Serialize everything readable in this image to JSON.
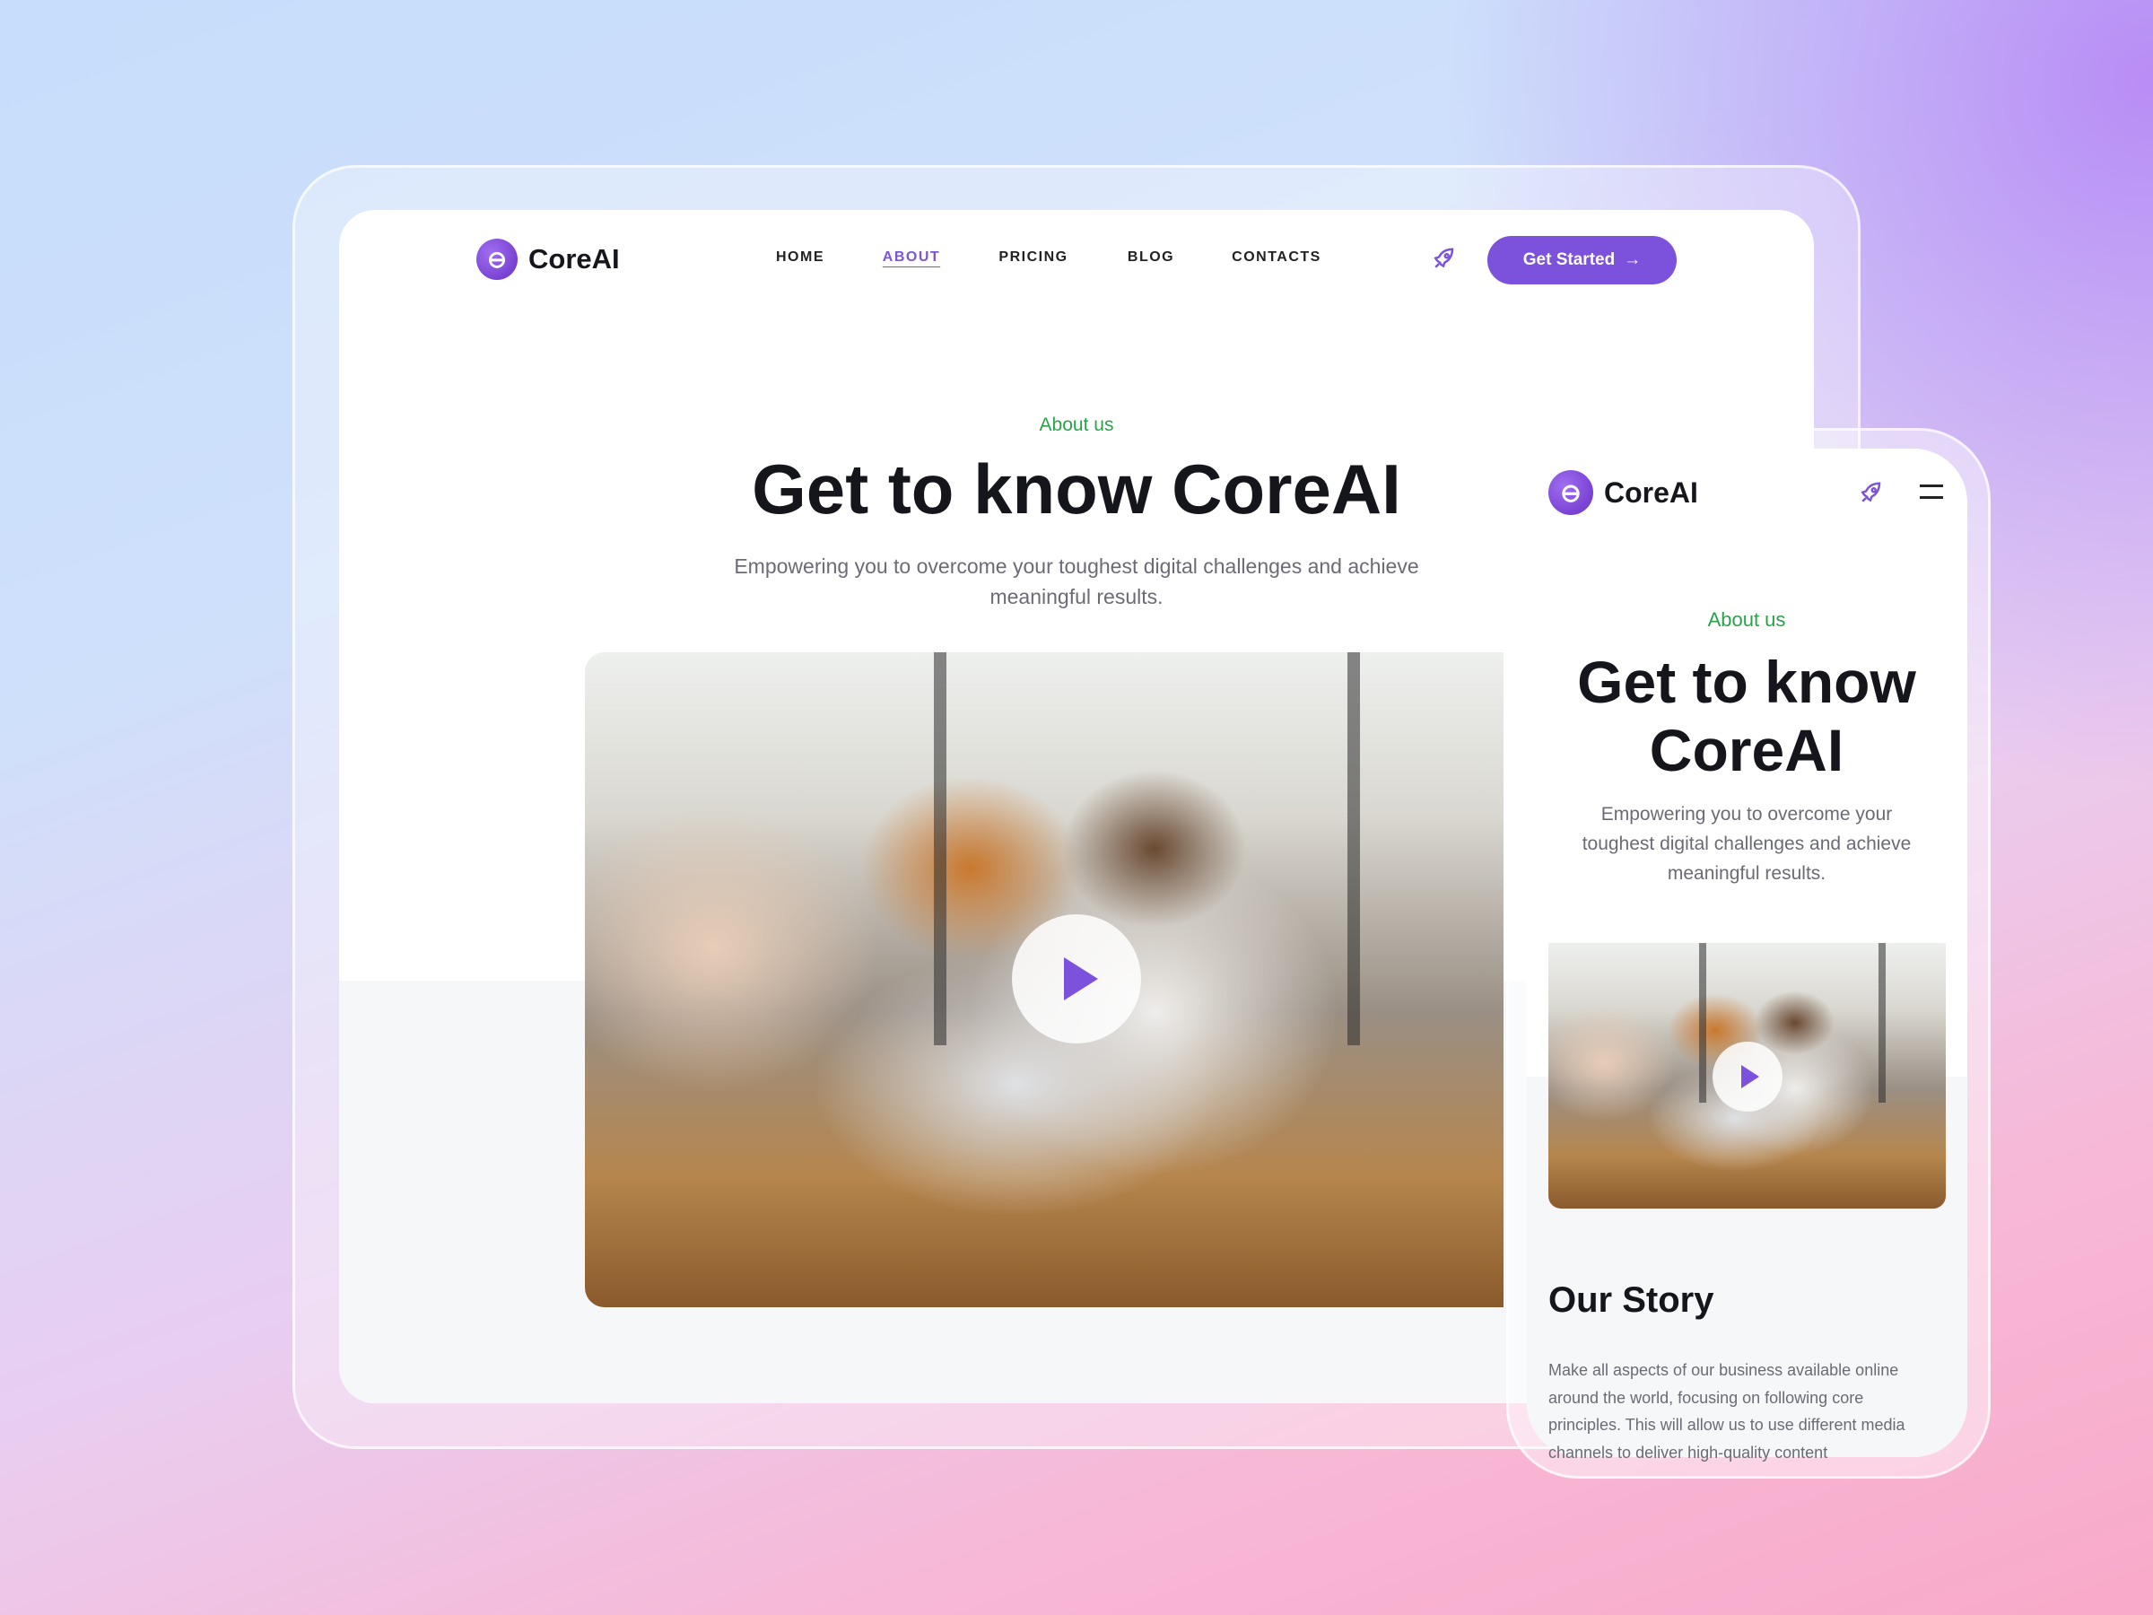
{
  "brand": {
    "name": "CoreAI",
    "accent": "#7c52dc",
    "eyebrow_color": "#2aa34a"
  },
  "desktop": {
    "nav": [
      {
        "label": "HOME"
      },
      {
        "label": "ABOUT",
        "active": true
      },
      {
        "label": "PRICING"
      },
      {
        "label": "BLOG"
      },
      {
        "label": "CONTACTS"
      }
    ],
    "cta": "Get Started",
    "eyebrow": "About us",
    "title": "Get to know CoreAI",
    "subtitle_1": "Empowering you to overcome your toughest digital challenges and achieve",
    "subtitle_2": "meaningful results."
  },
  "mobile": {
    "eyebrow": "About us",
    "title_1": "Get to know",
    "title_2": "CoreAI",
    "sub_1": "Empowering you to overcome your",
    "sub_2": "toughest digital challenges and achieve",
    "sub_3": "meaningful results.",
    "story_title": "Our Story",
    "story_lines": [
      "Make all aspects of our business available online",
      "around the world, focusing on following core",
      "principles. This will allow us to use different media",
      "channels to deliver high-quality content"
    ]
  },
  "icons": {
    "rocket": "rocket-icon",
    "menu": "hamburger-icon",
    "play": "play-icon",
    "arrow": "arrow-right-icon"
  }
}
